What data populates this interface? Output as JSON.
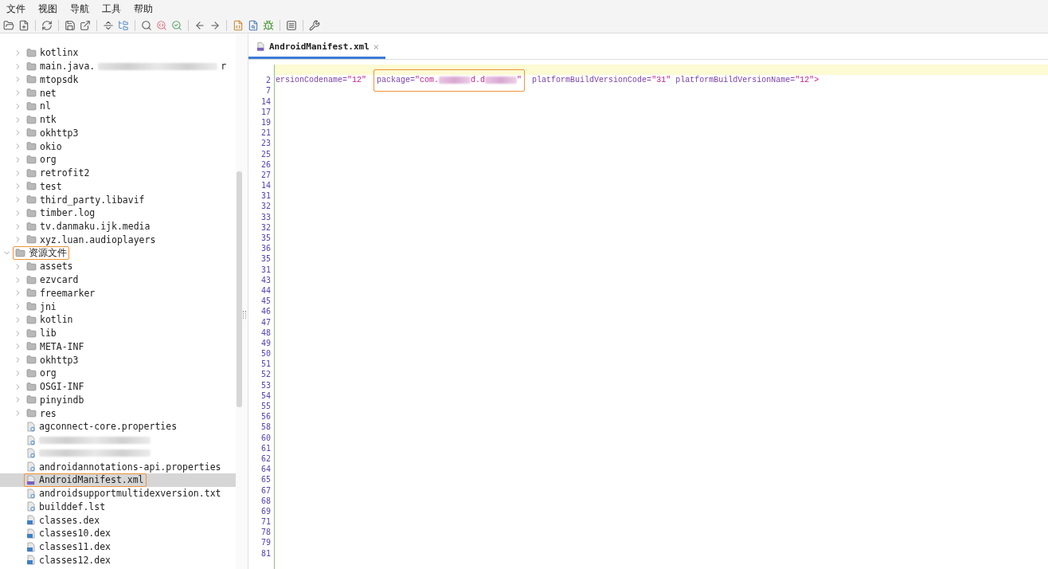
{
  "menu": [
    "文件",
    "视图",
    "导航",
    "工具",
    "帮助"
  ],
  "tree": {
    "scrolled_branch": [
      {
        "kind": "folder",
        "label": "kotlinx",
        "expanded": false,
        "outlined": false,
        "selected": false
      },
      {
        "kind": "folder",
        "label": "main.java.",
        "redacted": true,
        "tail": "r",
        "expanded": false,
        "outlined": false,
        "selected": false
      },
      {
        "kind": "folder",
        "label": "mtopsdk",
        "expanded": false,
        "outlined": false,
        "selected": false
      },
      {
        "kind": "folder",
        "label": "net",
        "expanded": false,
        "outlined": false,
        "selected": false
      },
      {
        "kind": "folder",
        "label": "nl",
        "expanded": false,
        "outlined": false,
        "selected": false
      },
      {
        "kind": "folder",
        "label": "ntk",
        "expanded": false,
        "outlined": false,
        "selected": false
      },
      {
        "kind": "folder",
        "label": "okhttp3",
        "expanded": false,
        "outlined": false,
        "selected": false
      },
      {
        "kind": "folder",
        "label": "okio",
        "expanded": false,
        "outlined": false,
        "selected": false
      },
      {
        "kind": "folder",
        "label": "org",
        "expanded": false,
        "outlined": false,
        "selected": false
      },
      {
        "kind": "folder",
        "label": "retrofit2",
        "expanded": false,
        "outlined": false,
        "selected": false
      },
      {
        "kind": "folder",
        "label": "test",
        "expanded": false,
        "outlined": false,
        "selected": false
      },
      {
        "kind": "folder",
        "label": "third_party.libavif",
        "expanded": false,
        "outlined": false,
        "selected": false
      },
      {
        "kind": "folder",
        "label": "timber.log",
        "expanded": false,
        "outlined": false,
        "selected": false
      },
      {
        "kind": "folder",
        "label": "tv.danmaku.ijk.media",
        "expanded": false,
        "outlined": false,
        "selected": false
      },
      {
        "kind": "folder",
        "label": "xyz.luan.audioplayers",
        "expanded": false,
        "outlined": false,
        "selected": false
      }
    ],
    "roots": [
      {
        "kind": "folder",
        "label": "资源文件",
        "expanded": true,
        "outlined": true,
        "selected": false,
        "children": [
          {
            "kind": "folder",
            "label": "assets",
            "expanded": false,
            "outlined": false,
            "selected": false
          },
          {
            "kind": "folder",
            "label": "ezvcard",
            "expanded": false,
            "outlined": false,
            "selected": false
          },
          {
            "kind": "folder",
            "label": "freemarker",
            "expanded": false,
            "outlined": false,
            "selected": false
          },
          {
            "kind": "folder",
            "label": "jni",
            "expanded": false,
            "outlined": false,
            "selected": false
          },
          {
            "kind": "folder",
            "label": "kotlin",
            "expanded": false,
            "outlined": false,
            "selected": false
          },
          {
            "kind": "folder",
            "label": "lib",
            "expanded": false,
            "outlined": false,
            "selected": false
          },
          {
            "kind": "folder",
            "label": "META-INF",
            "expanded": false,
            "outlined": false,
            "selected": false
          },
          {
            "kind": "folder",
            "label": "okhttp3",
            "expanded": false,
            "outlined": false,
            "selected": false
          },
          {
            "kind": "folder",
            "label": "org",
            "expanded": false,
            "outlined": false,
            "selected": false
          },
          {
            "kind": "folder",
            "label": "OSGI-INF",
            "expanded": false,
            "outlined": false,
            "selected": false
          },
          {
            "kind": "folder",
            "label": "pinyindb",
            "expanded": false,
            "outlined": false,
            "selected": false
          },
          {
            "kind": "folder",
            "label": "res",
            "expanded": false,
            "outlined": false,
            "selected": false
          },
          {
            "kind": "file",
            "label": "agconnect-core.properties",
            "outlined": false,
            "selected": false
          },
          {
            "kind": "file",
            "redacted": true,
            "outlined": false,
            "selected": false
          },
          {
            "kind": "file",
            "redacted": true,
            "outlined": false,
            "selected": false
          },
          {
            "kind": "file",
            "label": "androidannotations-api.properties",
            "outlined": false,
            "selected": false
          },
          {
            "kind": "manifest",
            "label": "AndroidManifest.xml",
            "outlined": true,
            "selected": true
          },
          {
            "kind": "file",
            "label": "androidsupportmultidexversion.txt",
            "outlined": false,
            "selected": false
          },
          {
            "kind": "file",
            "label": "builddef.lst",
            "outlined": false,
            "selected": false
          },
          {
            "kind": "dex",
            "label": "classes.dex",
            "outlined": false,
            "selected": false
          },
          {
            "kind": "dex",
            "label": "classes10.dex",
            "outlined": false,
            "selected": false
          },
          {
            "kind": "dex",
            "label": "classes11.dex",
            "outlined": false,
            "selected": false
          },
          {
            "kind": "dex",
            "label": "classes12.dex",
            "outlined": false,
            "selected": false
          }
        ]
      }
    ]
  },
  "tabs": [
    {
      "label": "AndroidManifest.xml",
      "selected": true,
      "close": "×"
    }
  ],
  "lines": [
    {
      "current": true
    },
    {
      "number": "2",
      "current": false,
      "attributes": [
        {
          "name": "ersionCodename=",
          "value": [
            {
              "kind": "text",
              "text": "\"12\""
            }
          ],
          "outlined": false
        },
        {
          "name": "package=",
          "value": [
            {
              "kind": "text",
              "text": "\"com."
            },
            {
              "kind": "redacted"
            },
            {
              "kind": "text",
              "text": "d.d"
            },
            {
              "kind": "redacted"
            },
            {
              "kind": "text",
              "text": "\""
            }
          ],
          "outlined": true
        },
        {
          "name": "platformBuildVersionCode=",
          "value": [
            {
              "kind": "text",
              "text": "\"31\""
            }
          ],
          "outlined": false
        },
        {
          "name": "platformBuildVersionName=",
          "value": [
            {
              "kind": "text",
              "text": "\"12\">"
            }
          ],
          "outlined": false
        }
      ]
    },
    {
      "number": "7",
      "current": false
    },
    {
      "number": "14",
      "current": false
    },
    {
      "number": "17",
      "current": false
    },
    {
      "number": "19",
      "current": false
    },
    {
      "number": "21",
      "current": false
    },
    {
      "number": "23",
      "current": false
    },
    {
      "number": "25",
      "current": false
    },
    {
      "number": "26",
      "current": false
    },
    {
      "number": "27",
      "current": false
    },
    {
      "number": "14",
      "current": false
    },
    {
      "number": "31",
      "current": false
    },
    {
      "number": "32",
      "current": false
    },
    {
      "number": "33",
      "current": false
    },
    {
      "number": "32",
      "current": false
    },
    {
      "number": "35",
      "current": false
    },
    {
      "number": "36",
      "current": false
    },
    {
      "number": "35",
      "current": false
    },
    {
      "number": "31",
      "current": false
    },
    {
      "number": "43",
      "current": false
    },
    {
      "number": "44",
      "current": false
    },
    {
      "number": "45",
      "current": false
    },
    {
      "number": "46",
      "current": false
    },
    {
      "number": "47",
      "current": false
    },
    {
      "number": "48",
      "current": false
    },
    {
      "number": "49",
      "current": false
    },
    {
      "number": "50",
      "current": false
    },
    {
      "number": "51",
      "current": false
    },
    {
      "number": "52",
      "current": false
    },
    {
      "number": "53",
      "current": false
    },
    {
      "number": "54",
      "current": false
    },
    {
      "number": "55",
      "current": false
    },
    {
      "number": "56",
      "current": false
    },
    {
      "number": "58",
      "current": false
    },
    {
      "number": "60",
      "current": false
    },
    {
      "number": "61",
      "current": false
    },
    {
      "number": "62",
      "current": false
    },
    {
      "number": "64",
      "current": false
    },
    {
      "number": "65",
      "current": false
    },
    {
      "number": "67",
      "current": false
    },
    {
      "number": "68",
      "current": false
    },
    {
      "number": "69",
      "current": false
    },
    {
      "number": "71",
      "current": false
    },
    {
      "number": "78",
      "current": false
    },
    {
      "number": "79",
      "current": false
    },
    {
      "number": "81",
      "current": false
    }
  ]
}
